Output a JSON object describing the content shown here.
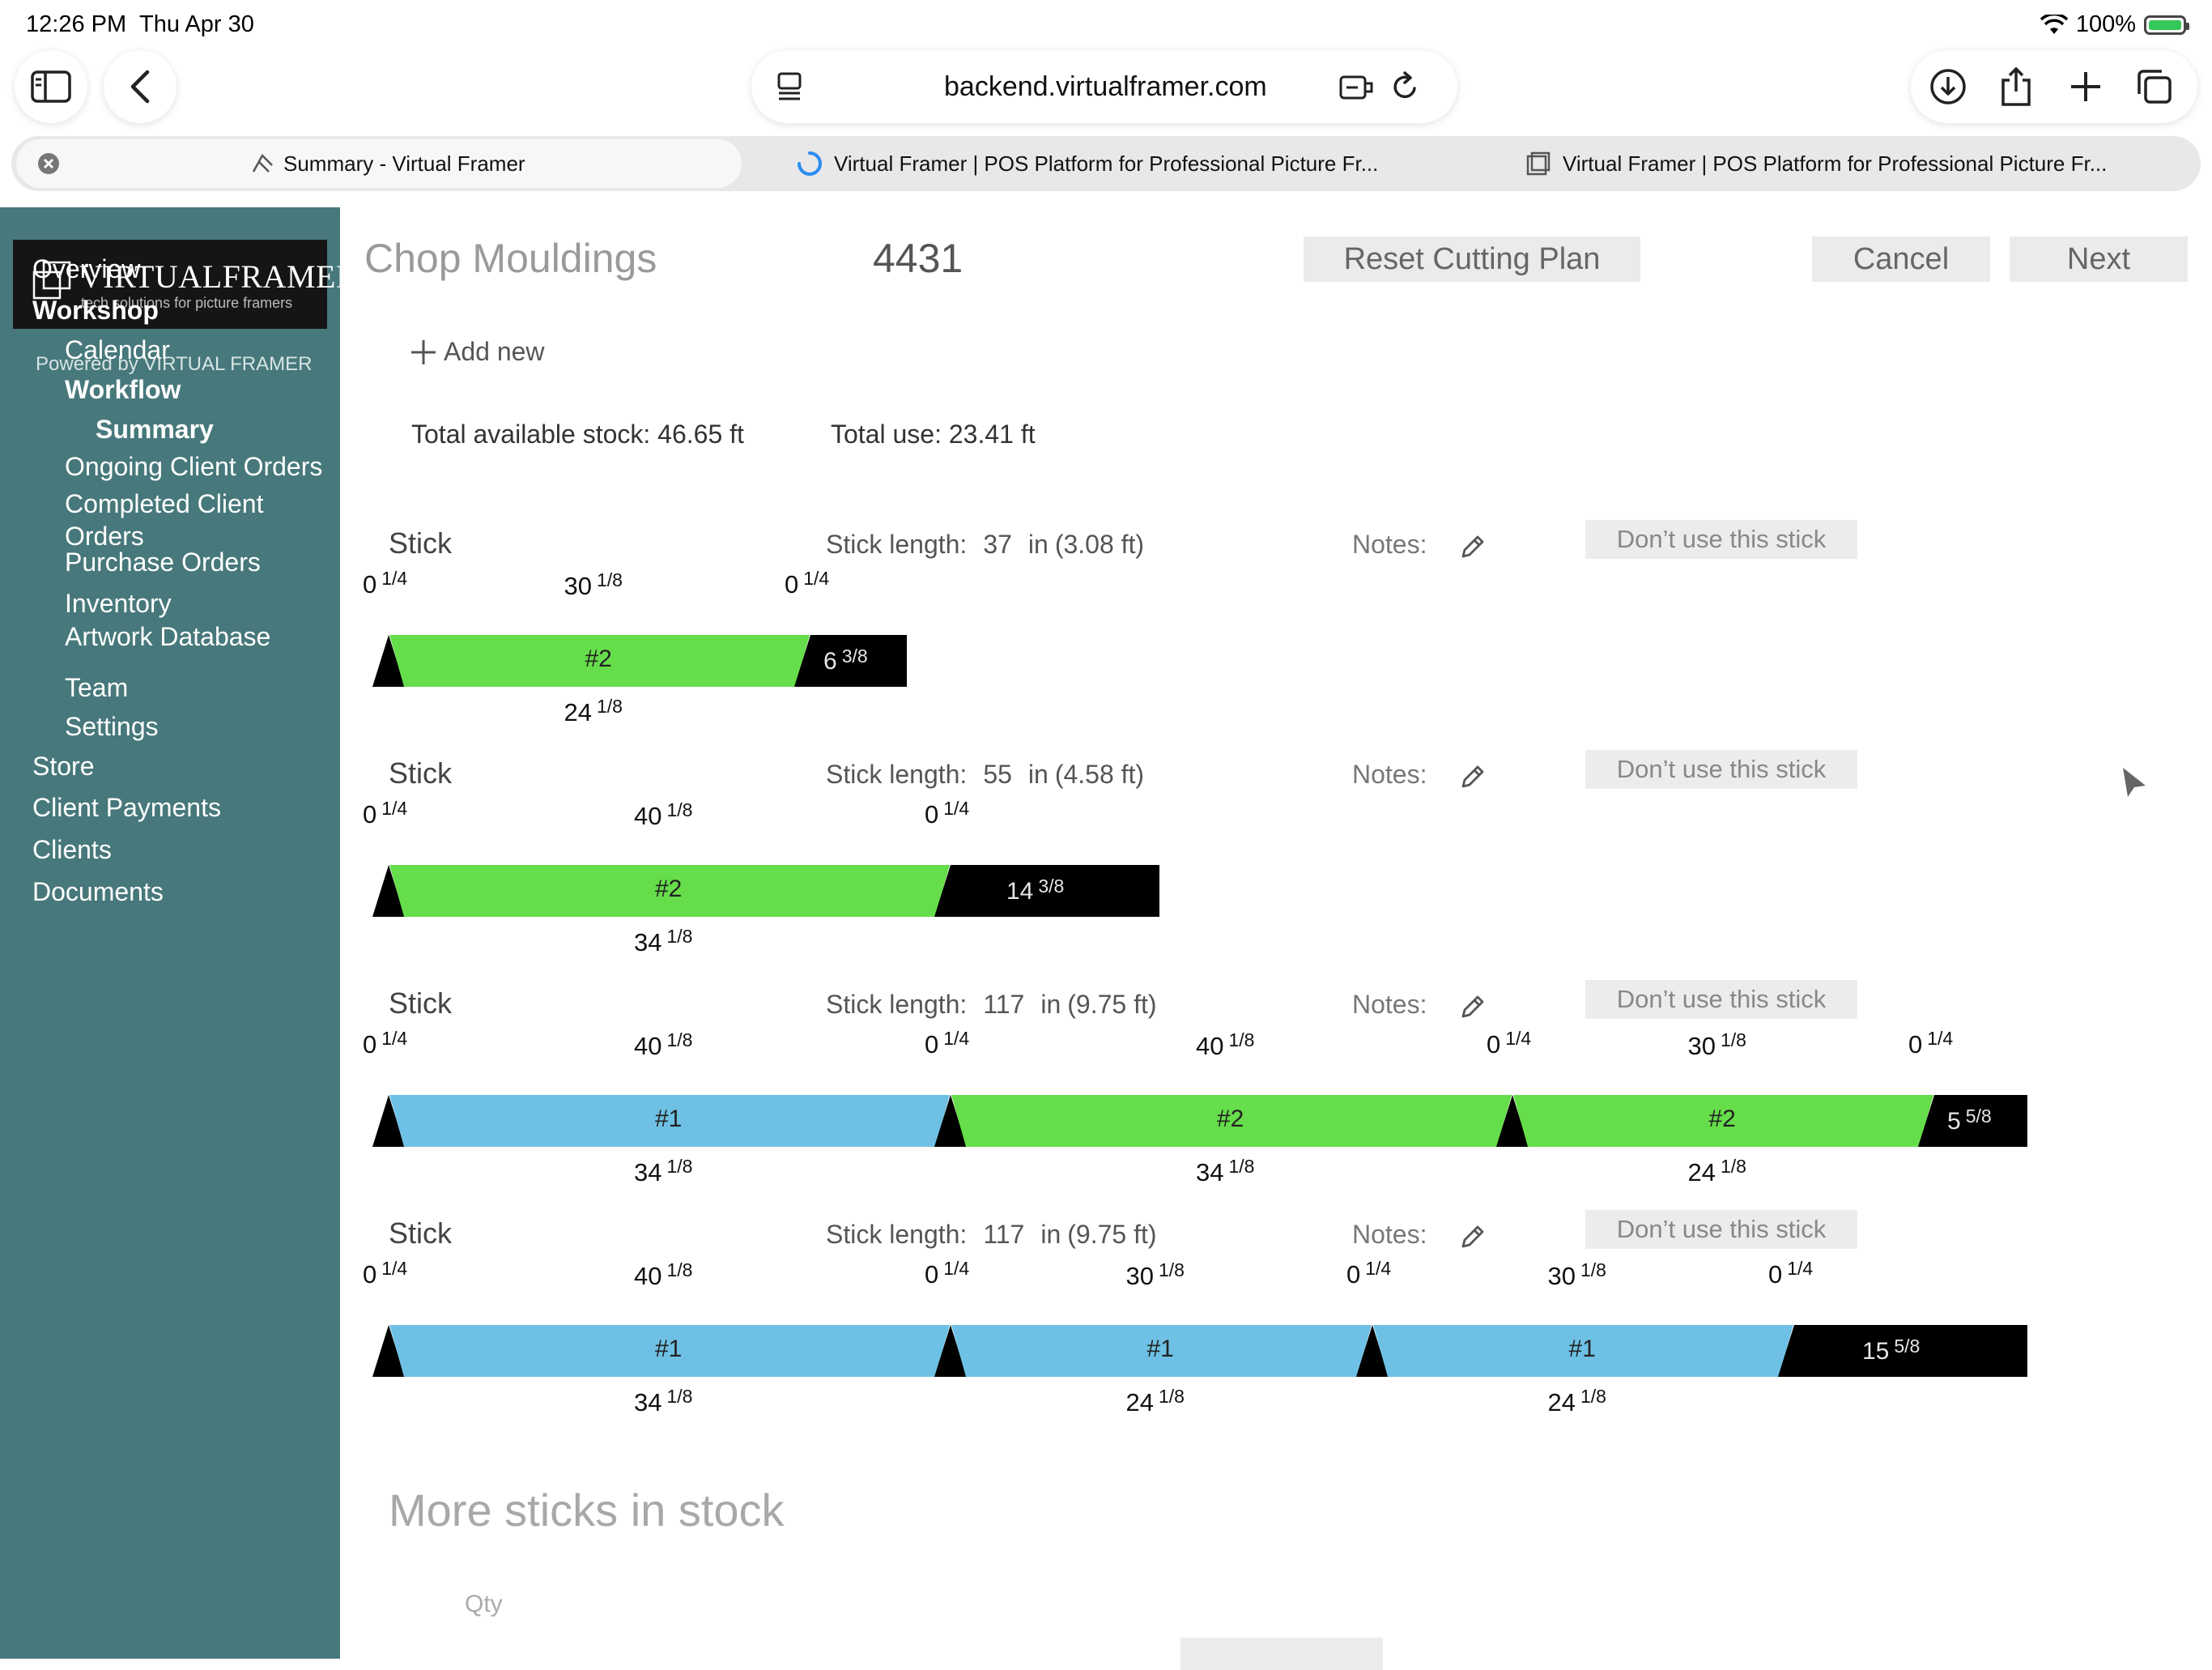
{
  "status_bar": {
    "time": "12:26 PM",
    "date": "Thu Apr 30",
    "battery": "100%"
  },
  "browser": {
    "url": "backend.virtualframer.com",
    "tabs": [
      {
        "title": "Summary - Virtual Framer",
        "active": true
      },
      {
        "title": "Virtual Framer | POS Platform for Professional Picture Fr...",
        "active": false
      },
      {
        "title": "Virtual Framer | POS Platform for Professional Picture Fr...",
        "active": false
      }
    ]
  },
  "logo": {
    "text_main": "VIRTUALFRAMER",
    "tagline": "tech solutions for picture framers",
    "powered_by": "Powered by VIRTUAL FRAMER"
  },
  "sidebar": {
    "items": [
      {
        "label": "Overview",
        "level": 0,
        "bold": false
      },
      {
        "label": "Workshop",
        "level": 0,
        "bold": true
      },
      {
        "label": "Calendar",
        "level": 1,
        "bold": false
      },
      {
        "label": "Workflow",
        "level": 1,
        "bold": true
      },
      {
        "label": "Summary",
        "level": 2,
        "bold": true
      },
      {
        "label": "Ongoing Client Orders",
        "level": 1,
        "bold": false
      },
      {
        "label": "Completed Client Orders",
        "level": 1,
        "bold": false
      },
      {
        "label": "Purchase Orders",
        "level": 1,
        "bold": false
      },
      {
        "label": "Inventory",
        "level": 1,
        "bold": false
      },
      {
        "label": "Artwork Database",
        "level": 1,
        "bold": false
      },
      {
        "label": "Team",
        "level": 1,
        "bold": false
      },
      {
        "label": "Settings",
        "level": 1,
        "bold": false
      },
      {
        "label": "Store",
        "level": 0,
        "bold": false
      },
      {
        "label": "Client Payments",
        "level": 0,
        "bold": false
      },
      {
        "label": "Clients",
        "level": 0,
        "bold": false
      },
      {
        "label": "Documents",
        "level": 0,
        "bold": false
      }
    ]
  },
  "header": {
    "title": "Chop Mouldings",
    "order_number": "4431",
    "reset_label": "Reset Cutting Plan",
    "cancel_label": "Cancel",
    "next_label": "Next"
  },
  "add_new_label": "Add new",
  "totals": {
    "available": "Total available stock: 46.65 ft",
    "use": "Total use: 23.41 ft"
  },
  "stick_labels": {
    "stick": "Stick",
    "length_prefix": "Stick length:",
    "unit": "in",
    "notes": "Notes:",
    "dont_use": "Don’t use this stick"
  },
  "colors": {
    "sidebar": "#47787b",
    "piece_1": "#6ec1e4",
    "piece_2": "#66dd4a",
    "waste": "#000000"
  },
  "sticks": [
    {
      "length": "37",
      "length_ft": "(3.08 ft)",
      "length_in": 37,
      "pieces": [
        {
          "id": "#2",
          "kind": 2,
          "top": "30",
          "top_frac": "1/8",
          "bottom": "24",
          "bottom_frac": "1/8",
          "kerf": "0",
          "kerf_frac": "1/4"
        }
      ],
      "end_kerf": "0",
      "end_kerf_frac": "1/4",
      "waste": "6",
      "waste_frac": "3/8"
    },
    {
      "length": "55",
      "length_ft": "(4.58 ft)",
      "length_in": 55,
      "pieces": [
        {
          "id": "#2",
          "kind": 2,
          "top": "40",
          "top_frac": "1/8",
          "bottom": "34",
          "bottom_frac": "1/8",
          "kerf": "0",
          "kerf_frac": "1/4"
        }
      ],
      "end_kerf": "0",
      "end_kerf_frac": "1/4",
      "waste": "14",
      "waste_frac": "3/8"
    },
    {
      "length": "117",
      "length_ft": "(9.75 ft)",
      "length_in": 117,
      "pieces": [
        {
          "id": "#1",
          "kind": 1,
          "top": "40",
          "top_frac": "1/8",
          "bottom": "34",
          "bottom_frac": "1/8",
          "kerf": "0",
          "kerf_frac": "1/4"
        },
        {
          "id": "#2",
          "kind": 2,
          "top": "40",
          "top_frac": "1/8",
          "bottom": "34",
          "bottom_frac": "1/8",
          "kerf": "0",
          "kerf_frac": "1/4"
        },
        {
          "id": "#2",
          "kind": 2,
          "top": "30",
          "top_frac": "1/8",
          "bottom": "24",
          "bottom_frac": "1/8",
          "kerf": "0",
          "kerf_frac": "1/4"
        }
      ],
      "end_kerf": "0",
      "end_kerf_frac": "1/4",
      "waste": "5",
      "waste_frac": "5/8"
    },
    {
      "length": "117",
      "length_ft": "(9.75 ft)",
      "length_in": 117,
      "pieces": [
        {
          "id": "#1",
          "kind": 1,
          "top": "40",
          "top_frac": "1/8",
          "bottom": "34",
          "bottom_frac": "1/8",
          "kerf": "0",
          "kerf_frac": "1/4"
        },
        {
          "id": "#1",
          "kind": 1,
          "top": "30",
          "top_frac": "1/8",
          "bottom": "24",
          "bottom_frac": "1/8",
          "kerf": "0",
          "kerf_frac": "1/4"
        },
        {
          "id": "#1",
          "kind": 1,
          "top": "30",
          "top_frac": "1/8",
          "bottom": "24",
          "bottom_frac": "1/8",
          "kerf": "0",
          "kerf_frac": "1/4"
        }
      ],
      "end_kerf": "0",
      "end_kerf_frac": "1/4",
      "waste": "15",
      "waste_frac": "5/8"
    }
  ],
  "more_sticks": {
    "title": "More sticks in stock",
    "qty_label": "Qty"
  }
}
